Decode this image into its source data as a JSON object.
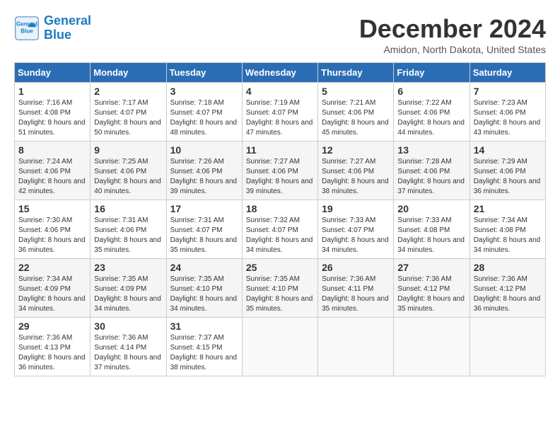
{
  "header": {
    "logo_line1": "General",
    "logo_line2": "Blue",
    "month": "December 2024",
    "location": "Amidon, North Dakota, United States"
  },
  "days_of_week": [
    "Sunday",
    "Monday",
    "Tuesday",
    "Wednesday",
    "Thursday",
    "Friday",
    "Saturday"
  ],
  "weeks": [
    [
      {
        "day": "1",
        "sunrise": "7:16 AM",
        "sunset": "4:08 PM",
        "daylight": "8 hours and 51 minutes."
      },
      {
        "day": "2",
        "sunrise": "7:17 AM",
        "sunset": "4:07 PM",
        "daylight": "8 hours and 50 minutes."
      },
      {
        "day": "3",
        "sunrise": "7:18 AM",
        "sunset": "4:07 PM",
        "daylight": "8 hours and 48 minutes."
      },
      {
        "day": "4",
        "sunrise": "7:19 AM",
        "sunset": "4:07 PM",
        "daylight": "8 hours and 47 minutes."
      },
      {
        "day": "5",
        "sunrise": "7:21 AM",
        "sunset": "4:06 PM",
        "daylight": "8 hours and 45 minutes."
      },
      {
        "day": "6",
        "sunrise": "7:22 AM",
        "sunset": "4:06 PM",
        "daylight": "8 hours and 44 minutes."
      },
      {
        "day": "7",
        "sunrise": "7:23 AM",
        "sunset": "4:06 PM",
        "daylight": "8 hours and 43 minutes."
      }
    ],
    [
      {
        "day": "8",
        "sunrise": "7:24 AM",
        "sunset": "4:06 PM",
        "daylight": "8 hours and 42 minutes."
      },
      {
        "day": "9",
        "sunrise": "7:25 AM",
        "sunset": "4:06 PM",
        "daylight": "8 hours and 40 minutes."
      },
      {
        "day": "10",
        "sunrise": "7:26 AM",
        "sunset": "4:06 PM",
        "daylight": "8 hours and 39 minutes."
      },
      {
        "day": "11",
        "sunrise": "7:27 AM",
        "sunset": "4:06 PM",
        "daylight": "8 hours and 39 minutes."
      },
      {
        "day": "12",
        "sunrise": "7:27 AM",
        "sunset": "4:06 PM",
        "daylight": "8 hours and 38 minutes."
      },
      {
        "day": "13",
        "sunrise": "7:28 AM",
        "sunset": "4:06 PM",
        "daylight": "8 hours and 37 minutes."
      },
      {
        "day": "14",
        "sunrise": "7:29 AM",
        "sunset": "4:06 PM",
        "daylight": "8 hours and 36 minutes."
      }
    ],
    [
      {
        "day": "15",
        "sunrise": "7:30 AM",
        "sunset": "4:06 PM",
        "daylight": "8 hours and 36 minutes."
      },
      {
        "day": "16",
        "sunrise": "7:31 AM",
        "sunset": "4:06 PM",
        "daylight": "8 hours and 35 minutes."
      },
      {
        "day": "17",
        "sunrise": "7:31 AM",
        "sunset": "4:07 PM",
        "daylight": "8 hours and 35 minutes."
      },
      {
        "day": "18",
        "sunrise": "7:32 AM",
        "sunset": "4:07 PM",
        "daylight": "8 hours and 34 minutes."
      },
      {
        "day": "19",
        "sunrise": "7:33 AM",
        "sunset": "4:07 PM",
        "daylight": "8 hours and 34 minutes."
      },
      {
        "day": "20",
        "sunrise": "7:33 AM",
        "sunset": "4:08 PM",
        "daylight": "8 hours and 34 minutes."
      },
      {
        "day": "21",
        "sunrise": "7:34 AM",
        "sunset": "4:08 PM",
        "daylight": "8 hours and 34 minutes."
      }
    ],
    [
      {
        "day": "22",
        "sunrise": "7:34 AM",
        "sunset": "4:09 PM",
        "daylight": "8 hours and 34 minutes."
      },
      {
        "day": "23",
        "sunrise": "7:35 AM",
        "sunset": "4:09 PM",
        "daylight": "8 hours and 34 minutes."
      },
      {
        "day": "24",
        "sunrise": "7:35 AM",
        "sunset": "4:10 PM",
        "daylight": "8 hours and 34 minutes."
      },
      {
        "day": "25",
        "sunrise": "7:35 AM",
        "sunset": "4:10 PM",
        "daylight": "8 hours and 35 minutes."
      },
      {
        "day": "26",
        "sunrise": "7:36 AM",
        "sunset": "4:11 PM",
        "daylight": "8 hours and 35 minutes."
      },
      {
        "day": "27",
        "sunrise": "7:36 AM",
        "sunset": "4:12 PM",
        "daylight": "8 hours and 35 minutes."
      },
      {
        "day": "28",
        "sunrise": "7:36 AM",
        "sunset": "4:12 PM",
        "daylight": "8 hours and 36 minutes."
      }
    ],
    [
      {
        "day": "29",
        "sunrise": "7:36 AM",
        "sunset": "4:13 PM",
        "daylight": "8 hours and 36 minutes."
      },
      {
        "day": "30",
        "sunrise": "7:36 AM",
        "sunset": "4:14 PM",
        "daylight": "8 hours and 37 minutes."
      },
      {
        "day": "31",
        "sunrise": "7:37 AM",
        "sunset": "4:15 PM",
        "daylight": "8 hours and 38 minutes."
      },
      null,
      null,
      null,
      null
    ]
  ]
}
